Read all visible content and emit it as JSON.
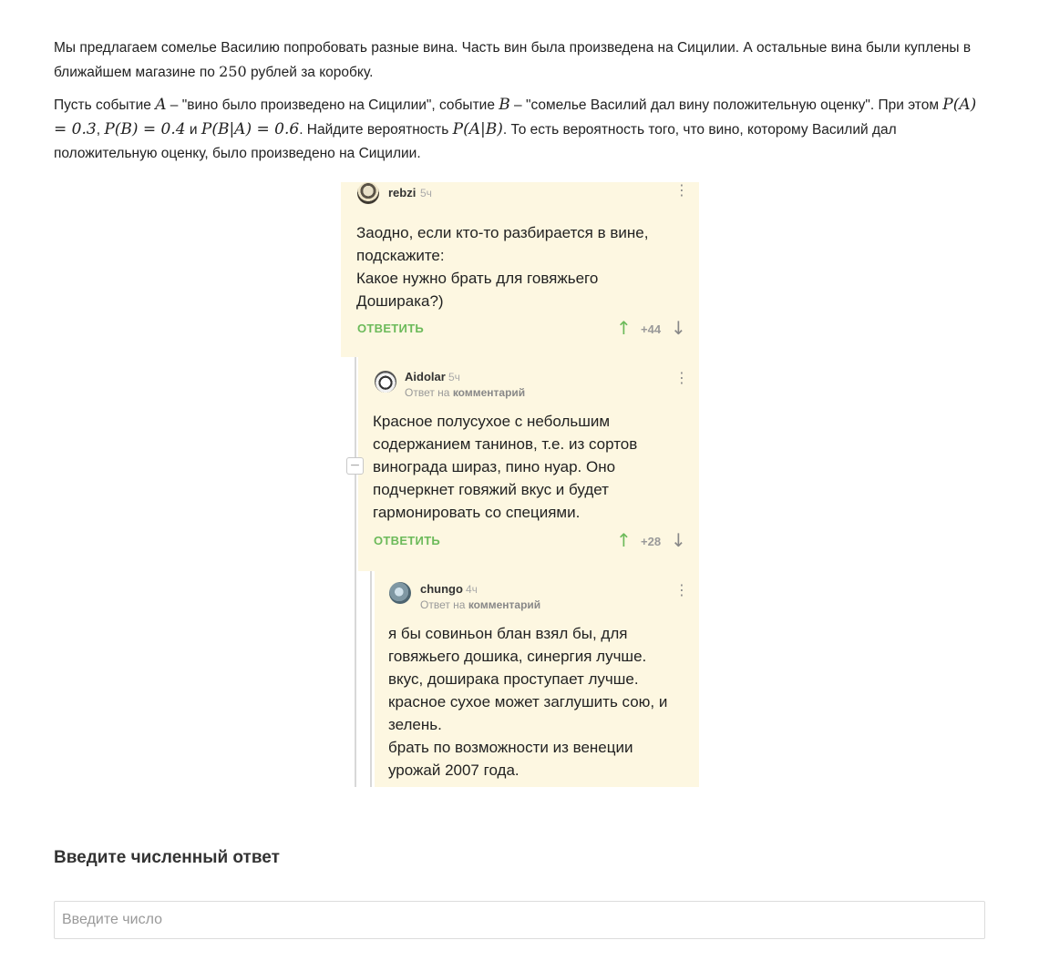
{
  "task": {
    "p1": {
      "text1": "Мы предлагаем сомелье Василию попробовать разные вина. Часть вин была произведена на Сицилии. А остальные вина были куплены в ближайшем магазине по ",
      "price": "250",
      "text2": " рублей за коробку."
    },
    "p2": {
      "t1": "Пусть событие ",
      "A": "A",
      "t2": " – \"вино было произведено на Сицилии\", событие ",
      "B": "B",
      "t3": " – \"сомелье Василий дал вину положительную оценку\". При этом ",
      "pa": "P(A) = 0.3",
      "sep1": ", ",
      "pb": "P(B) = 0.4",
      "sep2": " и ",
      "pba": "P(B|A) = 0.6",
      "t4": ". Найдите вероятность ",
      "pab": "P(A|B)",
      "t5": ". То есть вероятность того, что вино, которому Василий дал положительную оценку, было произведено на Сицилии."
    }
  },
  "comments": [
    {
      "user": "rebzi",
      "time": "5ч",
      "text": "Заодно, если кто-то разбирается в вине,\nподскажите:\nКакое нужно брать для говяжьего\nДоширака?)",
      "reply_label": "ОТВЕТИТЬ",
      "score": "+44",
      "up": "↑",
      "down": "↓",
      "menu": "⋮"
    },
    {
      "user": "Aidolar",
      "time": "5ч",
      "reply_to_prefix": "Ответ на",
      "reply_to_link": "комментарий",
      "text": "Красное полусухое с небольшим\nсодержанием танинов, т.е. из сортов\nвинограда шираз, пино нуар. Оно\nподчеркнет говяжий вкус и будет\nгармонировать со специями.",
      "reply_label": "ОТВЕТИТЬ",
      "score": "+28",
      "up": "↑",
      "down": "↓",
      "menu": "⋮"
    },
    {
      "user": "chungo",
      "time": "4ч",
      "reply_to_prefix": "Ответ на",
      "reply_to_link": "комментарий",
      "text": "я бы совиньон блан взял бы, для\nговяжьего дошика, синергия лучше.\nвкус, доширака проступает лучше.\nкрасное сухое может заглушить сою, и\nзелень.\nбрать по возможности из венеции\nурожай 2007 года.",
      "menu": "⋮"
    }
  ],
  "collapse_symbol": "−",
  "answer": {
    "title": "Введите численный ответ",
    "placeholder": "Введите число",
    "value": ""
  }
}
